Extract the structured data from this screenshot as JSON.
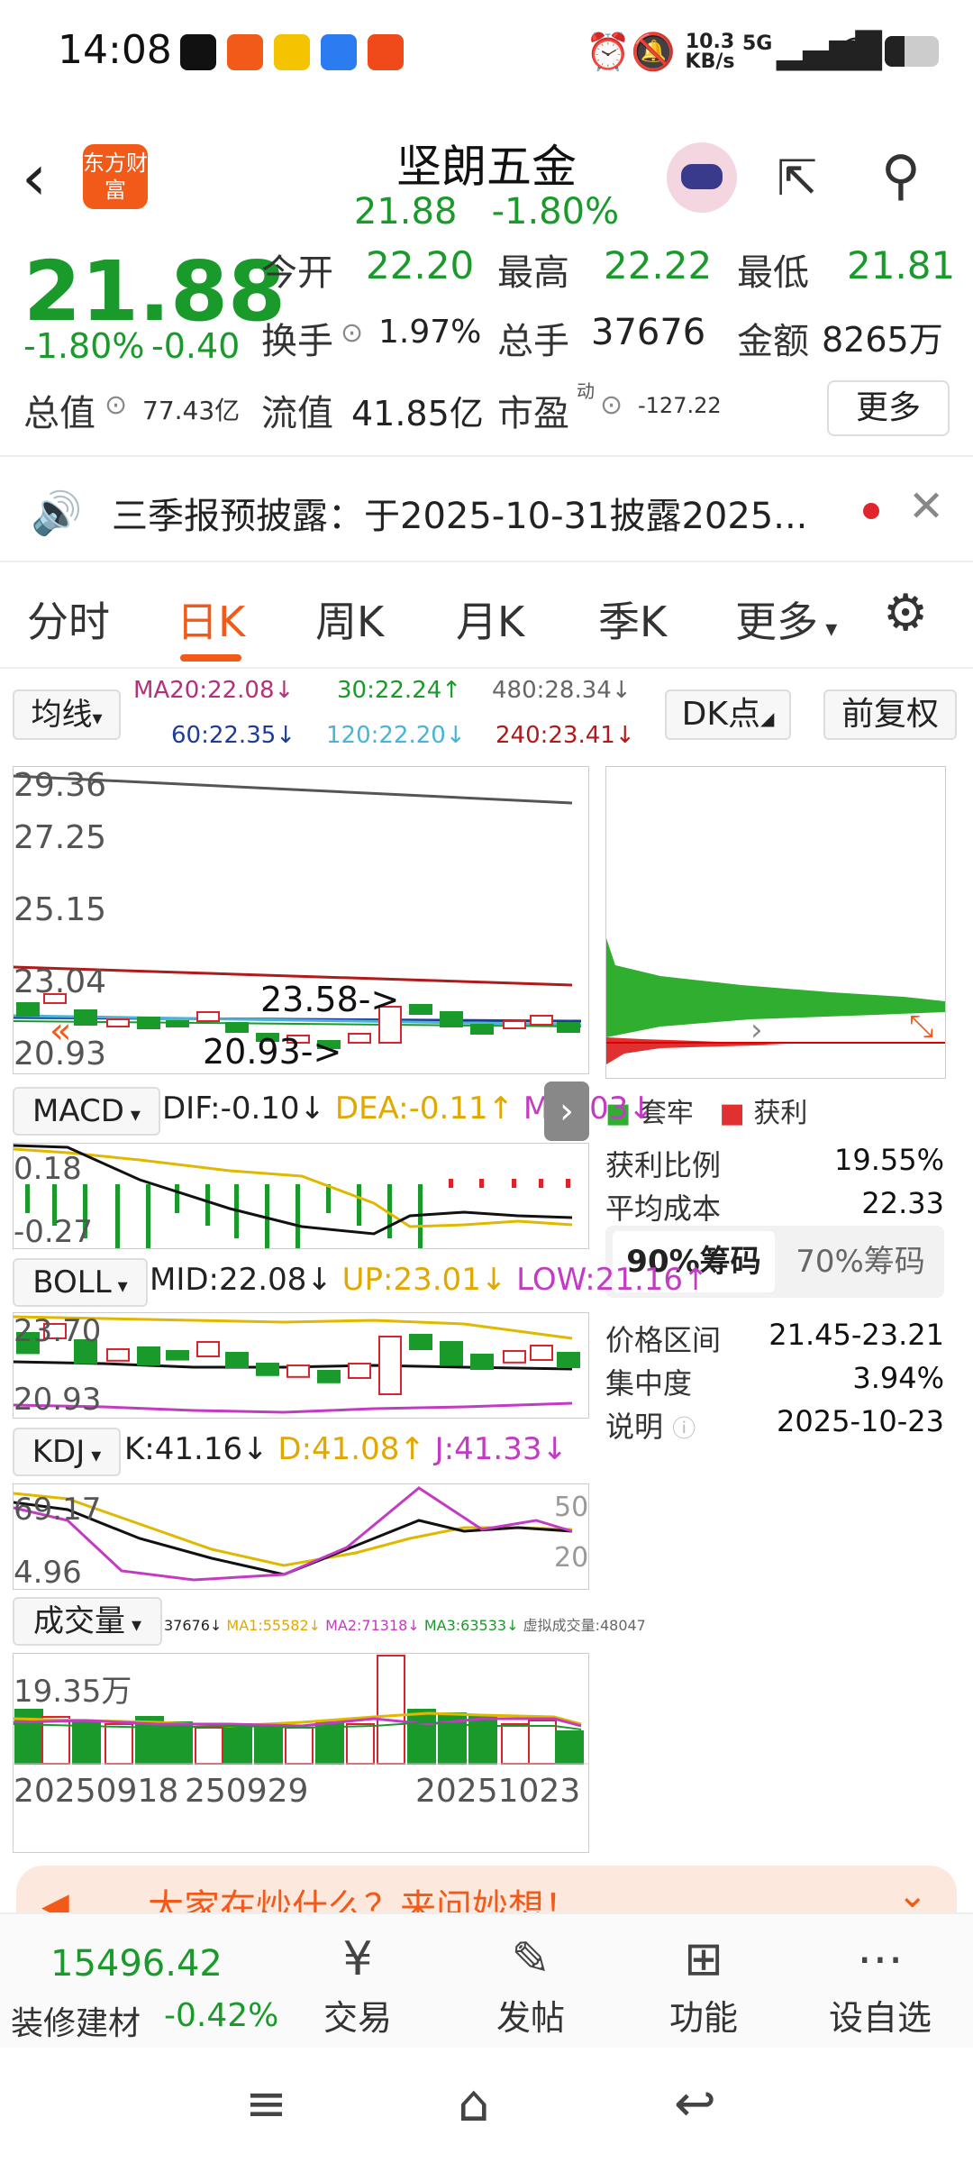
{
  "status": {
    "time": "14:08",
    "net_speed": "10.3 KB/s",
    "network": "5G"
  },
  "header": {
    "logo_text": "东方财富",
    "stock_name": "坚朗五金",
    "price": "21.88",
    "change_pct": "-1.80%"
  },
  "quote": {
    "price": "21.88",
    "change_pct": "-1.80%",
    "change_abs": "-0.40",
    "open_label": "今开",
    "open": "22.20",
    "high_label": "最高",
    "high": "22.22",
    "low_label": "最低",
    "low": "21.81",
    "turnover_label": "换手",
    "turnover": "1.97%",
    "volume_label": "总手",
    "volume": "37676",
    "amount_label": "金额",
    "amount": "8265万",
    "mktcap_label": "总值",
    "mktcap": "77.43亿",
    "float_label": "流值",
    "float_cap": "41.85亿",
    "pe_label": "市盈",
    "pe_sup": "动",
    "pe": "-127.22",
    "more_label": "更多"
  },
  "notice": {
    "text": "三季报预披露：于2025-10-31披露2025..."
  },
  "tabs": [
    "分时",
    "日K",
    "周K",
    "月K",
    "季K",
    "更多"
  ],
  "ma": {
    "selector": "均线",
    "ma20": "MA20:22.08↓",
    "ma30": "30:22.24↑",
    "ma480": "480:28.34↓",
    "ma60": "60:22.35↓",
    "ma120": "120:22.20↓",
    "ma240": "240:23.41↓",
    "dk_label": "DK点",
    "fq_label": "前复权"
  },
  "main_chart": {
    "ticks": [
      "29.36",
      "27.25",
      "25.15",
      "23.04",
      "20.93"
    ],
    "high_marker": "23.58->",
    "low_marker": "20.93->"
  },
  "macd": {
    "selector": "MACD",
    "dif": "DIF:-0.10↓",
    "dea": "DEA:-0.11↑",
    "m": "M:0.03↓",
    "ticks": [
      "0.18",
      "-0.27"
    ]
  },
  "boll": {
    "selector": "BOLL",
    "mid": "MID:22.08↓",
    "up": "UP:23.01↓",
    "low": "LOW:21.16↑",
    "ticks": [
      "23.70",
      "20.93"
    ]
  },
  "kdj": {
    "selector": "KDJ",
    "k": "K:41.16↓",
    "d": "D:41.08↑",
    "j": "J:41.33↓",
    "ticks": [
      "69.17",
      "4.96"
    ],
    "ref_high": "50",
    "ref_low": "20"
  },
  "vol": {
    "selector": "成交量",
    "v": "37676↓",
    "ma1": "MA1:55582↓",
    "ma2": "MA2:71318↓",
    "ma3": "MA3:63533↓",
    "virtual": "虚拟成交量:48047",
    "tick": "19.35万",
    "dates": [
      "20250918",
      "250929",
      "20251023"
    ]
  },
  "chips": {
    "legend_trapped": "套牢",
    "legend_profit": "获利",
    "profit_ratio_label": "获利比例",
    "profit_ratio": "19.55%",
    "avg_cost_label": "平均成本",
    "avg_cost": "22.33",
    "tab90": "90%筹码",
    "tab70": "70%筹码",
    "range_label": "价格区间",
    "range": "21.45-23.21",
    "concentration_label": "集中度",
    "concentration": "3.94%",
    "note_label": "说明",
    "note": "2025-10-23"
  },
  "ai_banner": "大家在炒什么？来问妙想！",
  "bottom": {
    "index_value": "15496.42",
    "index_name": "装修建材",
    "index_change": "-0.42%",
    "trade": "交易",
    "post": "发帖",
    "functions": "功能",
    "watchlist": "设自选"
  },
  "colors": {
    "up": "#d9232d",
    "down": "#1a9a2b",
    "accent": "#f25a1a"
  }
}
